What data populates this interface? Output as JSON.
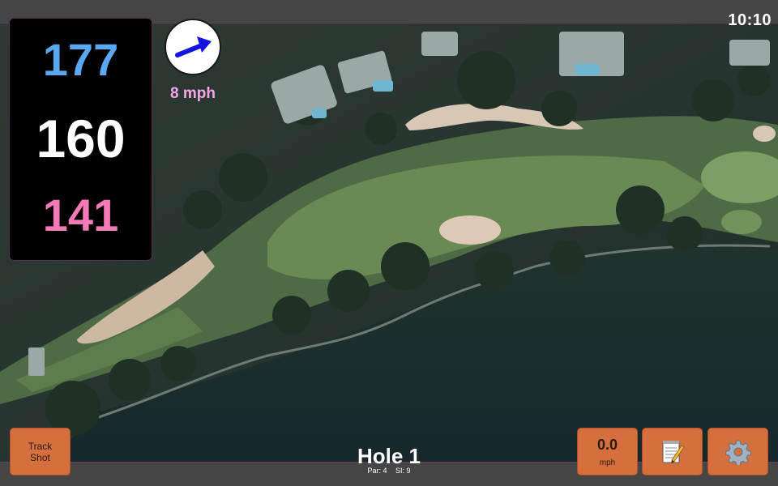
{
  "status": {
    "time": "10:10"
  },
  "distances": {
    "back": "177",
    "middle": "160",
    "front": "141"
  },
  "wind": {
    "speed": "8 mph",
    "direction_icon": "arrow-right-up-icon"
  },
  "hole": {
    "title": "Hole 1",
    "par_label": "Par: 4",
    "si_label": "SI: 9"
  },
  "buttons": {
    "track_shot_line1": "Track",
    "track_shot_line2": "Shot",
    "speed_value": "0.0",
    "speed_unit": "mph",
    "notes_icon": "notepad-pencil-icon",
    "settings_icon": "gear-icon"
  },
  "colors": {
    "back": "#5aa8f0",
    "middle": "#ffffff",
    "front": "#f37ab6",
    "wind_text": "#f7a5e8",
    "button": "#d5703e"
  }
}
